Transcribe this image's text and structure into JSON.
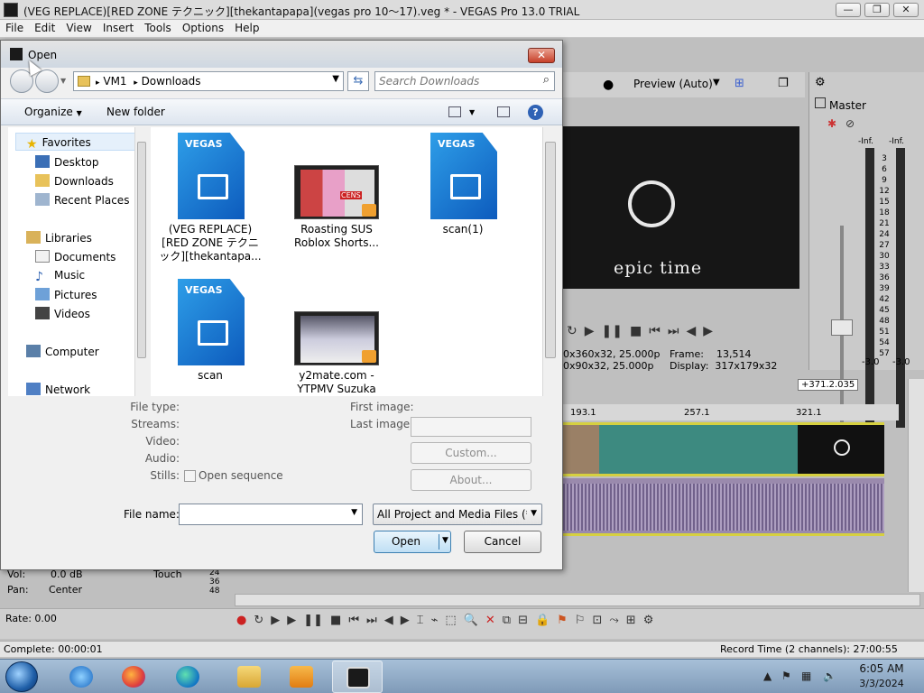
{
  "window": {
    "title": "(VEG REPLACE)[RED ZONE テクニック][thekantapapa](vegas pro 10〜17).veg * - VEGAS Pro 13.0 TRIAL",
    "controls": {
      "minimize": "—",
      "maximize": "❐",
      "close": "✕"
    }
  },
  "menu": [
    "File",
    "Edit",
    "View",
    "Insert",
    "Tools",
    "Options",
    "Help"
  ],
  "preview": {
    "quality": "Preview (Auto)",
    "screen_text": "epic time",
    "info": {
      "project_line": "0x360x32, 25.000p",
      "preview_line": "0x90x32, 25.000p",
      "frame_label": "Frame:",
      "frame_value": "13,514",
      "display_label": "Display:",
      "display_value": "317x179x32"
    }
  },
  "mixer": {
    "master_label": "Master",
    "inf_left": "-Inf.",
    "inf_right": "-Inf.",
    "scale": [
      "3",
      "6",
      "9",
      "12",
      "15",
      "18",
      "21",
      "24",
      "27",
      "30",
      "33",
      "36",
      "39",
      "42",
      "45",
      "48",
      "51",
      "54",
      "57"
    ],
    "level_left": "-3.0",
    "level_right": "-3.0"
  },
  "timeline": {
    "ruler": [
      "193.1",
      "257.1",
      "321.1"
    ],
    "timecode": "+371.2.035",
    "track": {
      "vol_label": "Vol:",
      "vol_value": "0.0 dB",
      "mode": "Touch",
      "pan_label": "Pan:",
      "pan_value": "Center",
      "meter_ticks": [
        "24",
        "36",
        "48"
      ]
    }
  },
  "transport": {
    "rate": "Rate: 0.00"
  },
  "status": {
    "complete": "Complete: 00:00:01",
    "record_time": "Record Time (2 channels): 27:00:55"
  },
  "taskbar": {
    "time": "6:05 AM",
    "date": "3/3/2024",
    "apps": [
      "start-orb",
      "internet-explorer-icon",
      "firefox-icon",
      "edge-icon",
      "file-explorer-icon",
      "media-player-icon",
      "vegas-icon"
    ]
  },
  "dialog": {
    "title": "Open",
    "close": "✕",
    "breadcrumb": [
      "VM1",
      "Downloads"
    ],
    "search_placeholder": "Search Downloads",
    "commands": {
      "organize": "Organize",
      "new_folder": "New folder"
    },
    "nav": {
      "favorites_label": "Favorites",
      "favorites": [
        "Desktop",
        "Downloads",
        "Recent Places"
      ],
      "libraries_label": "Libraries",
      "libraries": [
        "Documents",
        "Music",
        "Pictures",
        "Videos"
      ],
      "computer": "Computer",
      "network": "Network"
    },
    "files": [
      {
        "kind": "vegas",
        "icon_text": "VEGAS",
        "label": "(VEG REPLACE)[RED ZONE テクニック][thekantapa..."
      },
      {
        "kind": "video",
        "label": "Roasting SUS Roblox Shorts..."
      },
      {
        "kind": "vegas",
        "icon_text": "VEGAS",
        "label": "scan(1)"
      },
      {
        "kind": "vegas",
        "icon_text": "VEGAS",
        "label": "scan"
      },
      {
        "kind": "video",
        "label": "y2mate.com - YTPMV Suzuka"
      }
    ],
    "thumb_badge": "CENS",
    "info": {
      "file_type": "File type:",
      "streams": "Streams:",
      "video": "Video:",
      "audio": "Audio:",
      "stills": "Stills:",
      "open_sequence": "Open sequence",
      "first_image": "First image:",
      "last_image": "Last image:",
      "custom": "Custom...",
      "about": "About..."
    },
    "file_name_label": "File name:",
    "file_name_value": "",
    "file_type_value": "All Project and Media Files (*.veg",
    "open": "Open",
    "cancel": "Cancel"
  }
}
